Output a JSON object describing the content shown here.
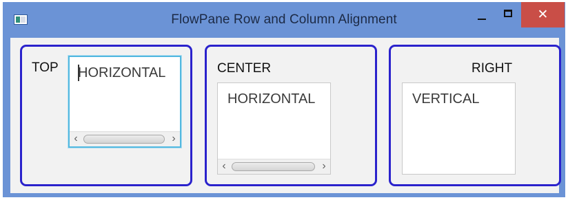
{
  "window": {
    "title": "FlowPane Row and Column Alignment",
    "icons": {
      "app": "app-icon",
      "minimize": "minimize-icon",
      "maximize": "maximize-icon",
      "close": "close-icon"
    },
    "close_glyph": "✕",
    "colors": {
      "titlebar": "#6b93d6",
      "close_button": "#c94e47",
      "pane_border": "#2a22cc",
      "focus_border": "#52b8e0"
    }
  },
  "panes": [
    {
      "label": "TOP",
      "textarea": {
        "value": "HORIZONTAL",
        "focused": true,
        "horizontal_scrollbar": true
      }
    },
    {
      "label": "CENTER",
      "textarea": {
        "value": "HORIZONTAL",
        "focused": false,
        "horizontal_scrollbar": true
      }
    },
    {
      "label": "RIGHT",
      "textarea": {
        "value": "VERTICAL",
        "focused": false,
        "horizontal_scrollbar": false
      }
    }
  ],
  "scrollbar": {
    "left_arrow": "‹",
    "right_arrow": "›"
  }
}
